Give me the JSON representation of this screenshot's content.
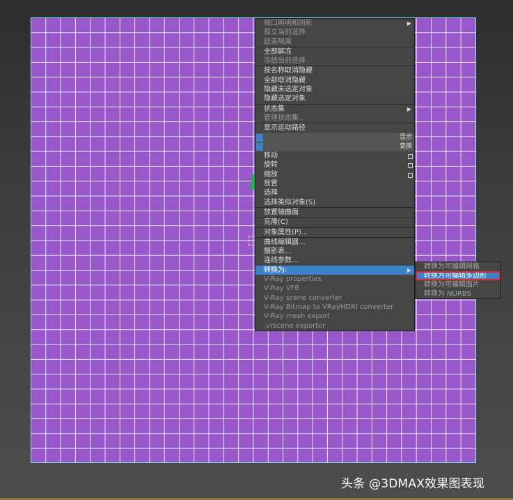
{
  "menu": {
    "items": [
      {
        "label": "视口照明和阴影",
        "arrow": "▶",
        "style": "dim"
      },
      {
        "label": "孤立当前选择",
        "style": "dim"
      },
      {
        "label": "结束隔离",
        "style": "dim"
      },
      {
        "label": "全部解冻",
        "style": "sep"
      },
      {
        "label": "冻结当前选择",
        "style": "dim"
      },
      {
        "label": "按名称取消隐藏",
        "style": "sep"
      },
      {
        "label": "全部取消隐藏",
        "style": ""
      },
      {
        "label": "隐藏未选定对象",
        "style": ""
      },
      {
        "label": "隐藏选定对象",
        "style": ""
      },
      {
        "label": "状态集",
        "arrow": "▶",
        "style": "sep"
      },
      {
        "label": "管理状态集...",
        "style": "dim"
      },
      {
        "label": "显示运动路径",
        "style": "sep"
      },
      {
        "label": "",
        "right": "显示",
        "style": "band"
      },
      {
        "label": "",
        "right": "变换",
        "style": "band"
      },
      {
        "label": "移动",
        "box": true,
        "style": ""
      },
      {
        "label": "旋转",
        "box": true,
        "style": ""
      },
      {
        "label": "缩放",
        "box": true,
        "style": ""
      },
      {
        "label": "放置",
        "style": ""
      },
      {
        "label": "选择",
        "style": ""
      },
      {
        "label": "选择类似对象(S)",
        "style": ""
      },
      {
        "label": "放置轴曲面",
        "style": "sep"
      },
      {
        "label": "克隆(C)",
        "style": "sep"
      },
      {
        "label": "对象属性(P)...",
        "style": "sep"
      },
      {
        "label": "曲线编辑器...",
        "style": "sep"
      },
      {
        "label": "摄影表...",
        "style": ""
      },
      {
        "label": "连线参数...",
        "style": ""
      },
      {
        "label": "转换为:",
        "arrow": "▶",
        "style": "hl"
      },
      {
        "label": "V-Ray properties",
        "style": "dim"
      },
      {
        "label": "V-Ray VFB",
        "style": "dim"
      },
      {
        "label": "V-Ray scene converter",
        "style": "dim"
      },
      {
        "label": "V-Ray Bitmap to VRayHDRI converter",
        "style": "dim"
      },
      {
        "label": "V-Ray mesh export",
        "style": "dim"
      },
      {
        "label": ".vrscene exporter",
        "style": "dim"
      }
    ]
  },
  "submenu": {
    "items": [
      {
        "label": "转换为可编辑网格",
        "style": ""
      },
      {
        "label": "转换为可编辑多边形",
        "style": "hl"
      },
      {
        "label": "转换为可编辑面片",
        "style": ""
      },
      {
        "label": "转换为 NURBS",
        "style": ""
      }
    ]
  },
  "watermark": {
    "text": "头条 @3DMAX效果图表现"
  },
  "colors": {
    "viewport": "#9858c9",
    "highlight": "#3d82c9",
    "selection_box": "#e0262e",
    "border": "#7fe7ee"
  }
}
